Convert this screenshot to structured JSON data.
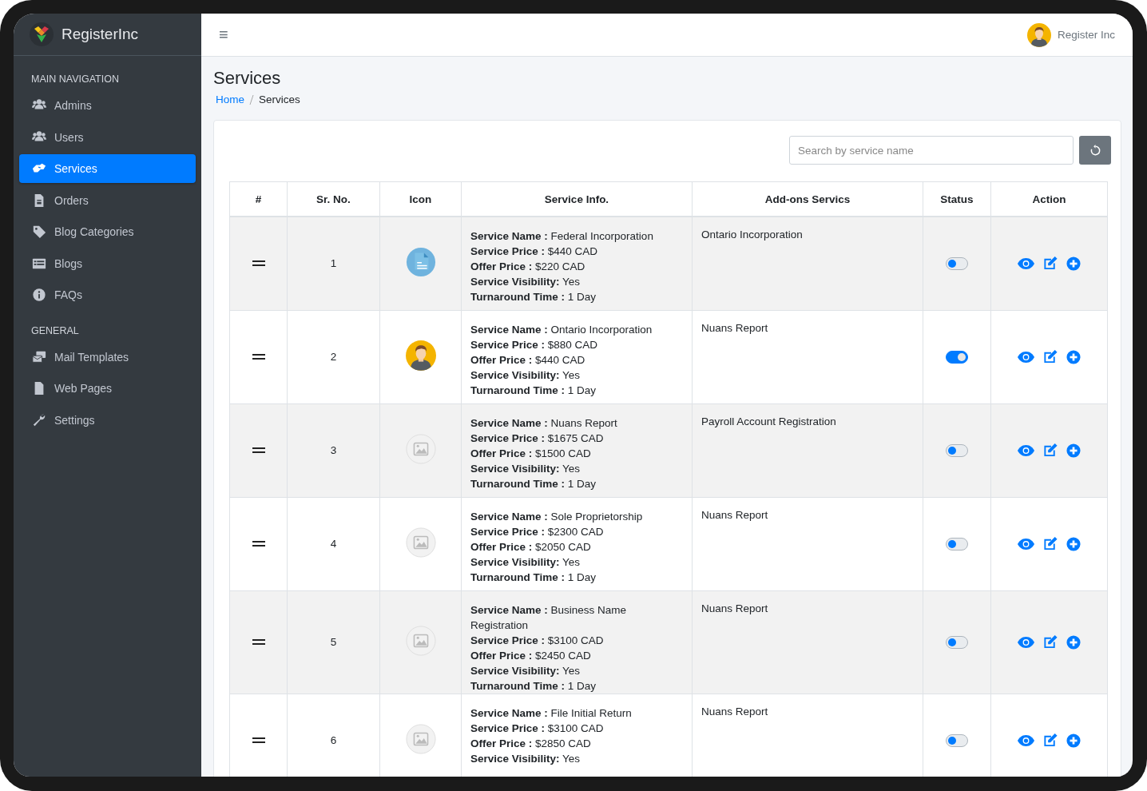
{
  "brand": {
    "name": "RegisterInc"
  },
  "sidebar": {
    "sections": [
      {
        "heading": "MAIN NAVIGATION",
        "items": [
          {
            "label": "Admins",
            "kind": "users",
            "selected": false
          },
          {
            "label": "Users",
            "kind": "users",
            "selected": false
          },
          {
            "label": "Services",
            "kind": "handshake",
            "selected": true
          },
          {
            "label": "Orders",
            "kind": "document",
            "selected": false
          },
          {
            "label": "Blog Categories",
            "kind": "tag",
            "selected": false
          },
          {
            "label": "Blogs",
            "kind": "list",
            "selected": false
          },
          {
            "label": "FAQs",
            "kind": "info",
            "selected": false
          }
        ]
      },
      {
        "heading": "GENERAL",
        "items": [
          {
            "label": "Mail Templates",
            "kind": "mail",
            "selected": false
          },
          {
            "label": "Web Pages",
            "kind": "page",
            "selected": false
          },
          {
            "label": "Settings",
            "kind": "wrench",
            "selected": false
          }
        ]
      }
    ]
  },
  "header": {
    "menu": "≡",
    "user": "Register Inc"
  },
  "page": {
    "title": "Services",
    "breadcrumb": [
      {
        "label": "Home",
        "kind": "link"
      },
      {
        "label": "Services",
        "kind": "current"
      }
    ]
  },
  "search": {
    "placeholder": "Search by service name"
  },
  "table": {
    "columns": [
      "#",
      "Sr. No.",
      "Icon",
      "Service Info.",
      "Add-ons Servics",
      "Status",
      "Action"
    ],
    "rows": [
      {
        "sr": "1",
        "kind": "document",
        "info": [
          {
            "label": "Service Name :",
            "value": "Federal Incorporation"
          },
          {
            "label": "Service Price :",
            "value": "$440 CAD"
          },
          {
            "label": "Offer Price :",
            "value": "$220 CAD"
          },
          {
            "label": "Service Visibility:",
            "value": "Yes"
          },
          {
            "label": "Turnaround Time :",
            "value": "1 Day"
          }
        ],
        "addons": "Ontario Incorporation",
        "on": false
      },
      {
        "sr": "2",
        "kind": "avatar",
        "info": [
          {
            "label": "Service Name :",
            "value": "Ontario Incorporation"
          },
          {
            "label": "Service Price :",
            "value": "$880 CAD"
          },
          {
            "label": "Offer Price :",
            "value": "$440 CAD"
          },
          {
            "label": "Service Visibility:",
            "value": "Yes"
          },
          {
            "label": "Turnaround Time :",
            "value": "1 Day"
          }
        ],
        "addons": "Nuans Report",
        "on": true
      },
      {
        "sr": "3",
        "kind": "placeholder",
        "info": [
          {
            "label": "Service Name :",
            "value": "Nuans Report"
          },
          {
            "label": "Service Price :",
            "value": "$1675 CAD"
          },
          {
            "label": "Offer Price :",
            "value": "$1500 CAD"
          },
          {
            "label": "Service Visibility:",
            "value": "Yes"
          },
          {
            "label": "Turnaround Time :",
            "value": "1 Day"
          }
        ],
        "addons": "Payroll Account Registration",
        "on": false
      },
      {
        "sr": "4",
        "kind": "placeholder",
        "info": [
          {
            "label": "Service Name :",
            "value": "Sole Proprietorship"
          },
          {
            "label": "Service Price :",
            "value": "$2300 CAD"
          },
          {
            "label": "Offer Price :",
            "value": "$2050 CAD"
          },
          {
            "label": "Service Visibility:",
            "value": "Yes"
          },
          {
            "label": "Turnaround Time :",
            "value": "1 Day"
          }
        ],
        "addons": "Nuans Report",
        "on": false
      },
      {
        "sr": "5",
        "kind": "placeholder",
        "info": [
          {
            "label": "Service Name :",
            "value": "Business Name Registration"
          },
          {
            "label": "Service Price :",
            "value": "$3100 CAD"
          },
          {
            "label": "Offer Price :",
            "value": "$2450 CAD"
          },
          {
            "label": "Service Visibility:",
            "value": "Yes"
          },
          {
            "label": "Turnaround Time :",
            "value": "1 Day"
          }
        ],
        "addons": "Nuans Report",
        "on": false
      },
      {
        "sr": "6",
        "kind": "placeholder",
        "info": [
          {
            "label": "Service Name :",
            "value": "File Initial Return"
          },
          {
            "label": "Service Price :",
            "value": "$3100 CAD"
          },
          {
            "label": "Offer Price :",
            "value": "$2850 CAD"
          },
          {
            "label": "Service Visibility:",
            "value": "Yes"
          }
        ],
        "addons": "Nuans Report",
        "on": false
      }
    ]
  }
}
